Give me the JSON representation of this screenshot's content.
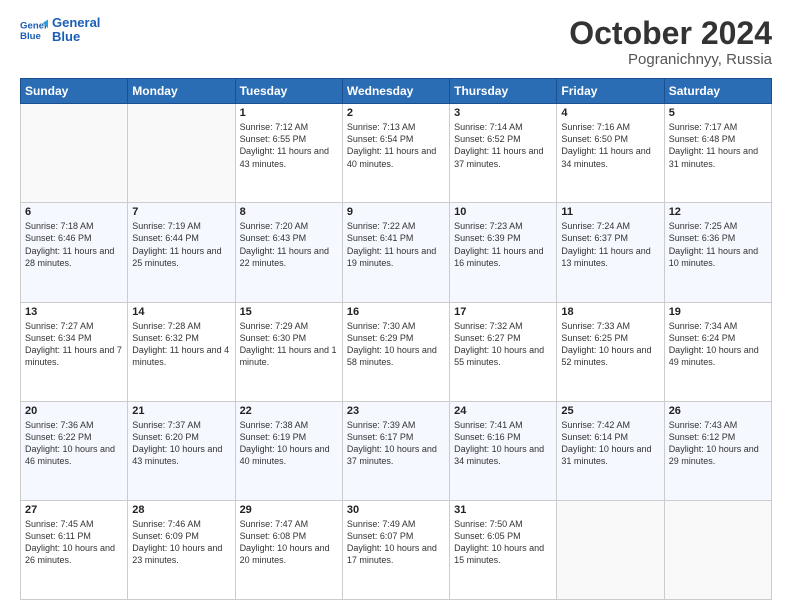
{
  "header": {
    "logo_line1": "General",
    "logo_line2": "Blue",
    "month": "October 2024",
    "location": "Pogranichnyy, Russia"
  },
  "days_of_week": [
    "Sunday",
    "Monday",
    "Tuesday",
    "Wednesday",
    "Thursday",
    "Friday",
    "Saturday"
  ],
  "weeks": [
    [
      {
        "num": "",
        "empty": true
      },
      {
        "num": "",
        "empty": true
      },
      {
        "num": "1",
        "sunrise": "7:12 AM",
        "sunset": "6:55 PM",
        "daylight": "11 hours and 43 minutes."
      },
      {
        "num": "2",
        "sunrise": "7:13 AM",
        "sunset": "6:54 PM",
        "daylight": "11 hours and 40 minutes."
      },
      {
        "num": "3",
        "sunrise": "7:14 AM",
        "sunset": "6:52 PM",
        "daylight": "11 hours and 37 minutes."
      },
      {
        "num": "4",
        "sunrise": "7:16 AM",
        "sunset": "6:50 PM",
        "daylight": "11 hours and 34 minutes."
      },
      {
        "num": "5",
        "sunrise": "7:17 AM",
        "sunset": "6:48 PM",
        "daylight": "11 hours and 31 minutes."
      }
    ],
    [
      {
        "num": "6",
        "sunrise": "7:18 AM",
        "sunset": "6:46 PM",
        "daylight": "11 hours and 28 minutes."
      },
      {
        "num": "7",
        "sunrise": "7:19 AM",
        "sunset": "6:44 PM",
        "daylight": "11 hours and 25 minutes."
      },
      {
        "num": "8",
        "sunrise": "7:20 AM",
        "sunset": "6:43 PM",
        "daylight": "11 hours and 22 minutes."
      },
      {
        "num": "9",
        "sunrise": "7:22 AM",
        "sunset": "6:41 PM",
        "daylight": "11 hours and 19 minutes."
      },
      {
        "num": "10",
        "sunrise": "7:23 AM",
        "sunset": "6:39 PM",
        "daylight": "11 hours and 16 minutes."
      },
      {
        "num": "11",
        "sunrise": "7:24 AM",
        "sunset": "6:37 PM",
        "daylight": "11 hours and 13 minutes."
      },
      {
        "num": "12",
        "sunrise": "7:25 AM",
        "sunset": "6:36 PM",
        "daylight": "11 hours and 10 minutes."
      }
    ],
    [
      {
        "num": "13",
        "sunrise": "7:27 AM",
        "sunset": "6:34 PM",
        "daylight": "11 hours and 7 minutes."
      },
      {
        "num": "14",
        "sunrise": "7:28 AM",
        "sunset": "6:32 PM",
        "daylight": "11 hours and 4 minutes."
      },
      {
        "num": "15",
        "sunrise": "7:29 AM",
        "sunset": "6:30 PM",
        "daylight": "11 hours and 1 minute."
      },
      {
        "num": "16",
        "sunrise": "7:30 AM",
        "sunset": "6:29 PM",
        "daylight": "10 hours and 58 minutes."
      },
      {
        "num": "17",
        "sunrise": "7:32 AM",
        "sunset": "6:27 PM",
        "daylight": "10 hours and 55 minutes."
      },
      {
        "num": "18",
        "sunrise": "7:33 AM",
        "sunset": "6:25 PM",
        "daylight": "10 hours and 52 minutes."
      },
      {
        "num": "19",
        "sunrise": "7:34 AM",
        "sunset": "6:24 PM",
        "daylight": "10 hours and 49 minutes."
      }
    ],
    [
      {
        "num": "20",
        "sunrise": "7:36 AM",
        "sunset": "6:22 PM",
        "daylight": "10 hours and 46 minutes."
      },
      {
        "num": "21",
        "sunrise": "7:37 AM",
        "sunset": "6:20 PM",
        "daylight": "10 hours and 43 minutes."
      },
      {
        "num": "22",
        "sunrise": "7:38 AM",
        "sunset": "6:19 PM",
        "daylight": "10 hours and 40 minutes."
      },
      {
        "num": "23",
        "sunrise": "7:39 AM",
        "sunset": "6:17 PM",
        "daylight": "10 hours and 37 minutes."
      },
      {
        "num": "24",
        "sunrise": "7:41 AM",
        "sunset": "6:16 PM",
        "daylight": "10 hours and 34 minutes."
      },
      {
        "num": "25",
        "sunrise": "7:42 AM",
        "sunset": "6:14 PM",
        "daylight": "10 hours and 31 minutes."
      },
      {
        "num": "26",
        "sunrise": "7:43 AM",
        "sunset": "6:12 PM",
        "daylight": "10 hours and 29 minutes."
      }
    ],
    [
      {
        "num": "27",
        "sunrise": "7:45 AM",
        "sunset": "6:11 PM",
        "daylight": "10 hours and 26 minutes."
      },
      {
        "num": "28",
        "sunrise": "7:46 AM",
        "sunset": "6:09 PM",
        "daylight": "10 hours and 23 minutes."
      },
      {
        "num": "29",
        "sunrise": "7:47 AM",
        "sunset": "6:08 PM",
        "daylight": "10 hours and 20 minutes."
      },
      {
        "num": "30",
        "sunrise": "7:49 AM",
        "sunset": "6:07 PM",
        "daylight": "10 hours and 17 minutes."
      },
      {
        "num": "31",
        "sunrise": "7:50 AM",
        "sunset": "6:05 PM",
        "daylight": "10 hours and 15 minutes."
      },
      {
        "num": "",
        "empty": true
      },
      {
        "num": "",
        "empty": true
      }
    ]
  ]
}
